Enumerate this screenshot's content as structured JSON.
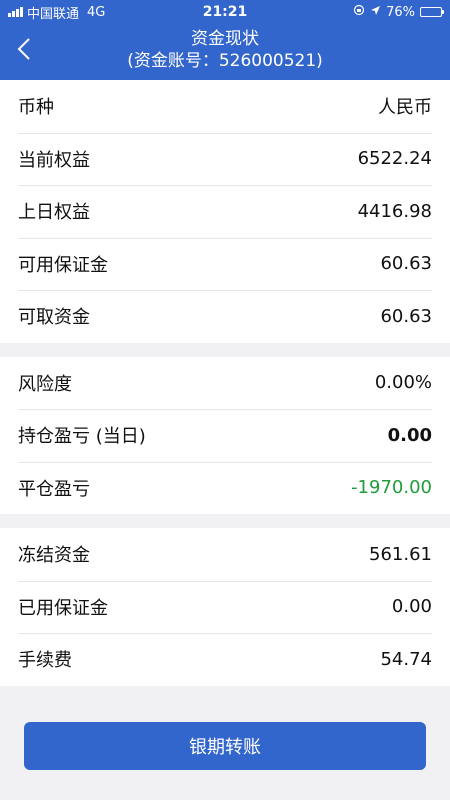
{
  "status_bar": {
    "carrier": "中国联通",
    "network": "4G",
    "time": "21:21",
    "battery": "76%",
    "battery_level": 0.76
  },
  "nav": {
    "title": "资金现状",
    "subtitle": "(资金账号：526000521)"
  },
  "groups": [
    [
      {
        "label": "币种",
        "value": "人民币"
      },
      {
        "label": "当前权益",
        "value": "6522.24"
      },
      {
        "label": "上日权益",
        "value": "4416.98"
      },
      {
        "label": "可用保证金",
        "value": "60.63"
      },
      {
        "label": "可取资金",
        "value": "60.63"
      }
    ],
    [
      {
        "label": "风险度",
        "value": "0.00%"
      },
      {
        "label": "持仓盈亏 (当日)",
        "value": "0.00"
      },
      {
        "label": "平仓盈亏",
        "value": "-1970.00"
      }
    ],
    [
      {
        "label": "冻结资金",
        "value": "561.61"
      },
      {
        "label": "已用保证金",
        "value": "0.00"
      },
      {
        "label": "手续费",
        "value": "54.74"
      }
    ]
  ],
  "transfer_button": "银期转账",
  "colors": {
    "primary": "#3366cc",
    "loss_green": "#1f9e3a",
    "background": "#f1f1f4"
  }
}
